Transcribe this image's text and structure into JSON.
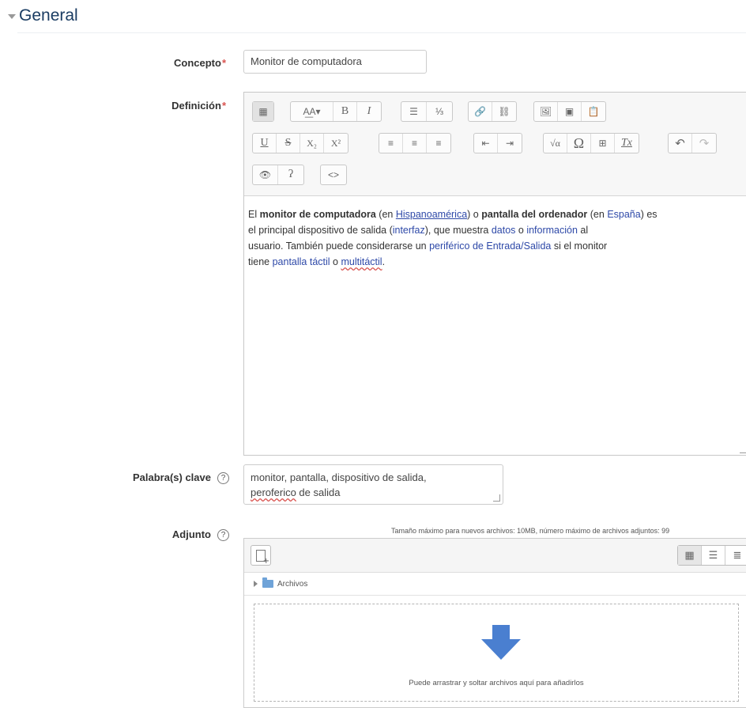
{
  "section": {
    "title": "General"
  },
  "concepto": {
    "label": "Concepto",
    "required_mark": "*",
    "value": "Monitor de computadora"
  },
  "definicion": {
    "label": "Definición",
    "required_mark": "*",
    "toolbar": {
      "row1": [
        {
          "icon": "toggle-toolbar-icon",
          "glyph": "▦"
        },
        {
          "icon": "font-style-icon",
          "glyph": "A͟A▾"
        },
        {
          "icon": "bold-icon",
          "glyph": "B"
        },
        {
          "icon": "italic-icon",
          "glyph": "I"
        },
        {
          "icon": "unordered-list-icon",
          "glyph": "☰"
        },
        {
          "icon": "ordered-list-icon",
          "glyph": "⅓"
        },
        {
          "icon": "link-icon",
          "glyph": "🔗"
        },
        {
          "icon": "unlink-icon",
          "glyph": "⛓"
        },
        {
          "icon": "image-icon",
          "glyph": "🖼"
        },
        {
          "icon": "media-icon",
          "glyph": "▣"
        },
        {
          "icon": "paste-icon",
          "glyph": "📋"
        }
      ],
      "row2": [
        {
          "icon": "underline-icon",
          "glyph": "U"
        },
        {
          "icon": "strikethrough-icon",
          "glyph": "S"
        },
        {
          "icon": "subscript-icon",
          "glyph": "X₂"
        },
        {
          "icon": "superscript-icon",
          "glyph": "X²"
        },
        {
          "icon": "align-left-icon",
          "glyph": "≡"
        },
        {
          "icon": "align-center-icon",
          "glyph": "≡"
        },
        {
          "icon": "align-right-icon",
          "glyph": "≡"
        },
        {
          "icon": "outdent-icon",
          "glyph": "⇤"
        },
        {
          "icon": "indent-icon",
          "glyph": "⇥"
        },
        {
          "icon": "equation-icon",
          "glyph": "√α"
        },
        {
          "icon": "special-char-icon",
          "glyph": "Ω"
        },
        {
          "icon": "table-icon",
          "glyph": "⊞"
        },
        {
          "icon": "clear-format-icon",
          "glyph": "Tx"
        },
        {
          "icon": "undo-icon",
          "glyph": "↶"
        },
        {
          "icon": "redo-icon",
          "glyph": "↷"
        }
      ],
      "row3": [
        {
          "icon": "accessibility-checker-icon",
          "glyph": "👁"
        },
        {
          "icon": "screenreader-helper-icon",
          "glyph": "ʔ"
        },
        {
          "icon": "html-icon",
          "glyph": "<>"
        }
      ]
    },
    "content": {
      "l1_a": "El ",
      "l1_b": "monitor de computadora",
      "l1_c": " (en ",
      "l1_d": "Hispanoamérica",
      "l1_e": ") o ",
      "l1_f": "pantalla del ordenador",
      "l1_g": " (en ",
      "l1_h": "España",
      "l1_i": ") es",
      "l2_a": "el principal dispositivo de salida (",
      "l2_b": "interfaz",
      "l2_c": "), que muestra ",
      "l2_d": "datos",
      "l2_e": " o ",
      "l2_f": "información",
      "l2_g": " al",
      "l3_a": "usuario. También puede considerarse un ",
      "l3_b": "periférico de Entrada/Salida",
      "l3_c": " si el monitor",
      "l4_a": "tiene ",
      "l4_b": "pantalla táctil",
      "l4_c": " o ",
      "l4_d": "multitáctil",
      "l4_e": "."
    }
  },
  "palabras": {
    "label": "Palabra(s) clave",
    "help": "?",
    "line1": "monitor, pantalla, dispositivo de salida,",
    "line2_a": "peroferico",
    "line2_b": " de salida"
  },
  "adjunto": {
    "label": "Adjunto",
    "help": "?",
    "max_note": "Tamaño máximo para nuevos archivos: 10MB, número máximo de archivos adjuntos: 99",
    "path": "Archivos",
    "drop_text": "Puede arrastrar y soltar archivos aquí para añadirlos",
    "accent_color": "#4a7fd0"
  }
}
